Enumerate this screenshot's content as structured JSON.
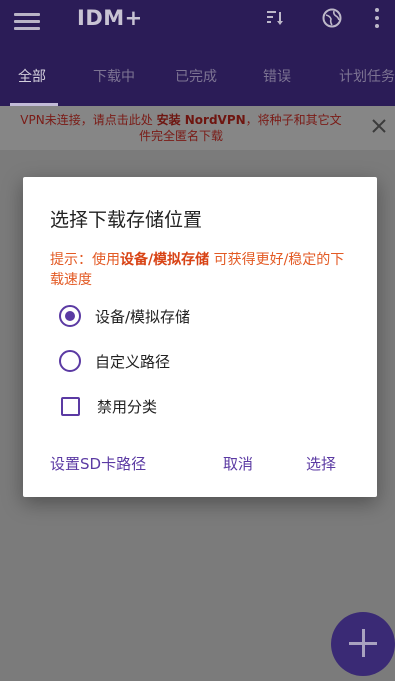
{
  "app": {
    "title": "IDM+"
  },
  "tabs": [
    {
      "label": "全部",
      "active": true
    },
    {
      "label": "下载中",
      "active": false
    },
    {
      "label": "已完成",
      "active": false
    },
    {
      "label": "错误",
      "active": false
    },
    {
      "label": "计划任务",
      "active": false
    }
  ],
  "notice": {
    "line1_prefix": "VPN未连接，请点击此处",
    "link": "安装 NordVPN",
    "line1_suffix": "，将种子和其它文",
    "line2": "件完全匿名下载"
  },
  "dialog": {
    "title": "选择下载存储位置",
    "hint_prefix": "提示：使用",
    "hint_highlight": "设备/模拟存储",
    "hint_suffix": " 可获得更好/稳定的下载速度",
    "options": [
      {
        "label": "设备/模拟存储",
        "type": "radio",
        "checked": true
      },
      {
        "label": "自定义路径",
        "type": "radio",
        "checked": false
      },
      {
        "label": "禁用分类",
        "type": "checkbox",
        "checked": false
      }
    ],
    "actions": {
      "sd_path": "设置SD卡路径",
      "cancel": "取消",
      "select": "选择"
    }
  },
  "colors": {
    "accent": "#5b3aa3",
    "hint": "#e35a24",
    "appbar": "#2b1c57"
  }
}
